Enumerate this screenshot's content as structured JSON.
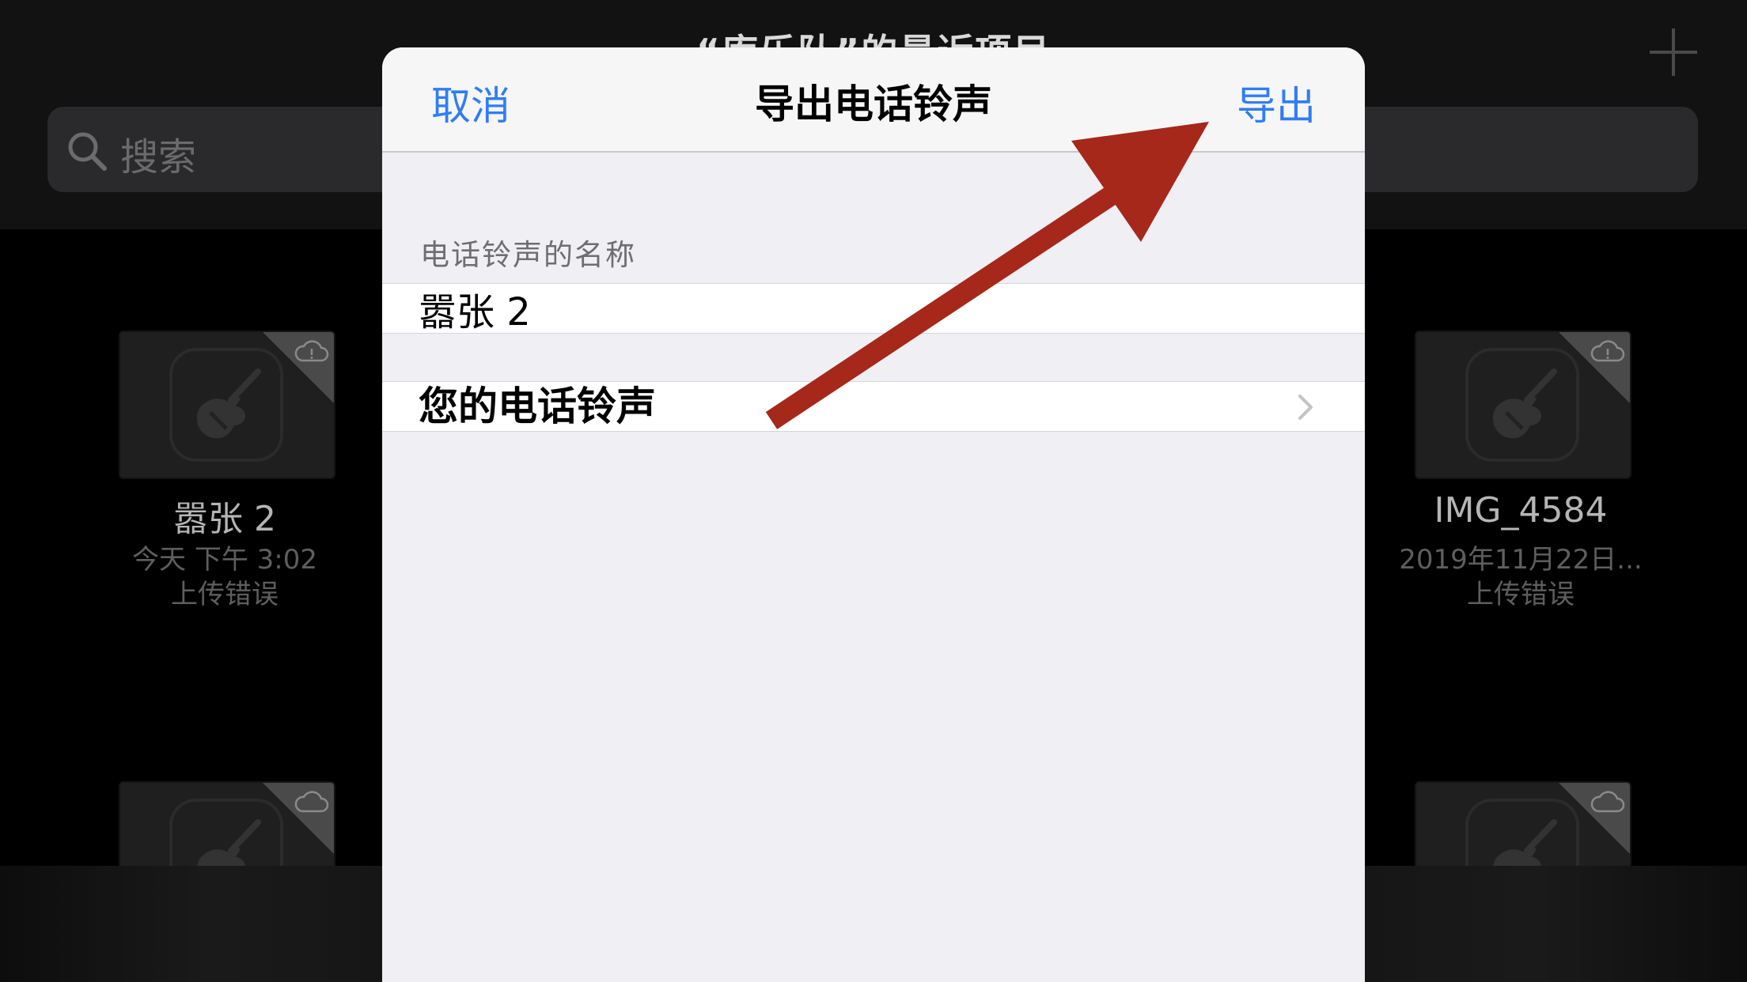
{
  "background": {
    "title": "“库乐队”的最近项目",
    "search_placeholder": "搜索",
    "tiles": [
      {
        "title": "嚣张 2",
        "date": "今天 下午 3:02",
        "status": "上传错误"
      },
      {
        "title": "IMG_4584",
        "date": "2019年11月22日...",
        "status": "上传错误"
      }
    ]
  },
  "sheet": {
    "cancel_label": "取消",
    "title": "导出电话铃声",
    "export_label": "导出",
    "name_section_header": "电话铃声的名称",
    "name_value": "嚣张 2",
    "ringtones_label": "您的电话铃声"
  },
  "colors": {
    "accent": "#2f7df6",
    "annotation_arrow": "#a5281a",
    "sheet_background": "#efeff4"
  },
  "icons": [
    "plus-icon",
    "search-icon",
    "garageband-guitar-icon",
    "cloud-error-icon",
    "chevron-right-icon",
    "annotation-arrow"
  ]
}
